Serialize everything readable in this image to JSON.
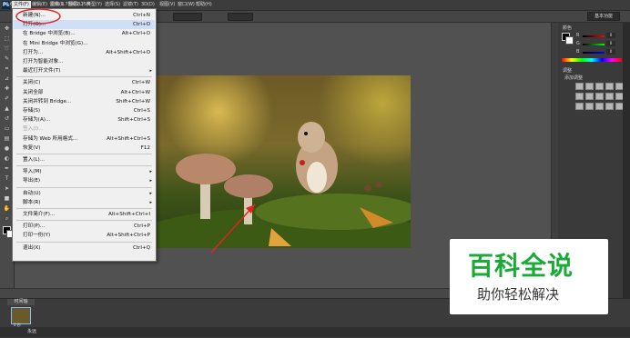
{
  "menubar": {
    "logo": "Ps",
    "items": [
      "文件(F)",
      "编辑(E)",
      "图像(I)",
      "图层(L)",
      "类型(Y)",
      "选择(S)",
      "滤镜(T)",
      "3D(D)",
      "视图(V)",
      "窗口(W)",
      "帮助(H)"
    ],
    "active_index": 0
  },
  "options_bar": {
    "workspace": "基本功能"
  },
  "file_menu": {
    "items": [
      {
        "label": "新建(N)...",
        "shortcut": "Ctrl+N",
        "enabled": true
      },
      {
        "label": "打开(O)...",
        "shortcut": "Ctrl+O",
        "enabled": true
      },
      {
        "label": "在 Bridge 中浏览(B)...",
        "shortcut": "Alt+Ctrl+O",
        "enabled": true
      },
      {
        "label": "在 Mini Bridge 中浏览(G)...",
        "shortcut": "",
        "enabled": true
      },
      {
        "label": "打开为...",
        "shortcut": "Alt+Shift+Ctrl+O",
        "enabled": true
      },
      {
        "label": "打开为智能对象...",
        "shortcut": "",
        "enabled": true
      },
      {
        "label": "最近打开文件(T)",
        "shortcut": "",
        "enabled": true,
        "submenu": true
      },
      {
        "label": "关闭(C)",
        "shortcut": "Ctrl+W",
        "enabled": true
      },
      {
        "label": "关闭全部",
        "shortcut": "Alt+Ctrl+W",
        "enabled": true
      },
      {
        "label": "关闭并转到 Bridge...",
        "shortcut": "Shift+Ctrl+W",
        "enabled": true
      },
      {
        "label": "存储(S)",
        "shortcut": "Ctrl+S",
        "enabled": true
      },
      {
        "label": "存储为(A)...",
        "shortcut": "Shift+Ctrl+S",
        "enabled": true
      },
      {
        "label": "签入(I)...",
        "shortcut": "",
        "enabled": false
      },
      {
        "label": "存储为 Web 所用格式...",
        "shortcut": "Alt+Shift+Ctrl+S",
        "enabled": true
      },
      {
        "label": "恢复(V)",
        "shortcut": "F12",
        "enabled": true
      },
      {
        "label": "置入(L)...",
        "shortcut": "",
        "enabled": true
      },
      {
        "label": "导入(M)",
        "shortcut": "",
        "enabled": true,
        "submenu": true
      },
      {
        "label": "导出(E)",
        "shortcut": "",
        "enabled": true,
        "submenu": true
      },
      {
        "label": "自动(U)",
        "shortcut": "",
        "enabled": true,
        "submenu": true
      },
      {
        "label": "脚本(R)",
        "shortcut": "",
        "enabled": true,
        "submenu": true
      },
      {
        "label": "文件简介(F)...",
        "shortcut": "Alt+Shift+Ctrl+I",
        "enabled": true
      },
      {
        "label": "打印(P)...",
        "shortcut": "Ctrl+P",
        "enabled": true
      },
      {
        "label": "打印一份(Y)",
        "shortcut": "Alt+Shift+Ctrl+P",
        "enabled": true
      },
      {
        "label": "退出(X)",
        "shortcut": "Ctrl+Q",
        "enabled": true
      }
    ]
  },
  "status": {
    "zoom": "66.67%",
    "doc": "文档:1.75M/2.75M"
  },
  "timeline": {
    "tab": "时间轴",
    "frame_time": "0 秒",
    "loop": "永远"
  },
  "panels": {
    "color_tab": "颜色",
    "rgb": [
      {
        "ch": "R",
        "val": "0"
      },
      {
        "ch": "G",
        "val": "0"
      },
      {
        "ch": "B",
        "val": "0"
      }
    ],
    "adjust_tab": "调整",
    "adjust_label": "添加调整"
  },
  "watermark": {
    "title": "百科全说",
    "subtitle": "助你轻松解决"
  },
  "colors": {
    "annotation": "#e02424",
    "watermark_green": "#1aab37"
  }
}
